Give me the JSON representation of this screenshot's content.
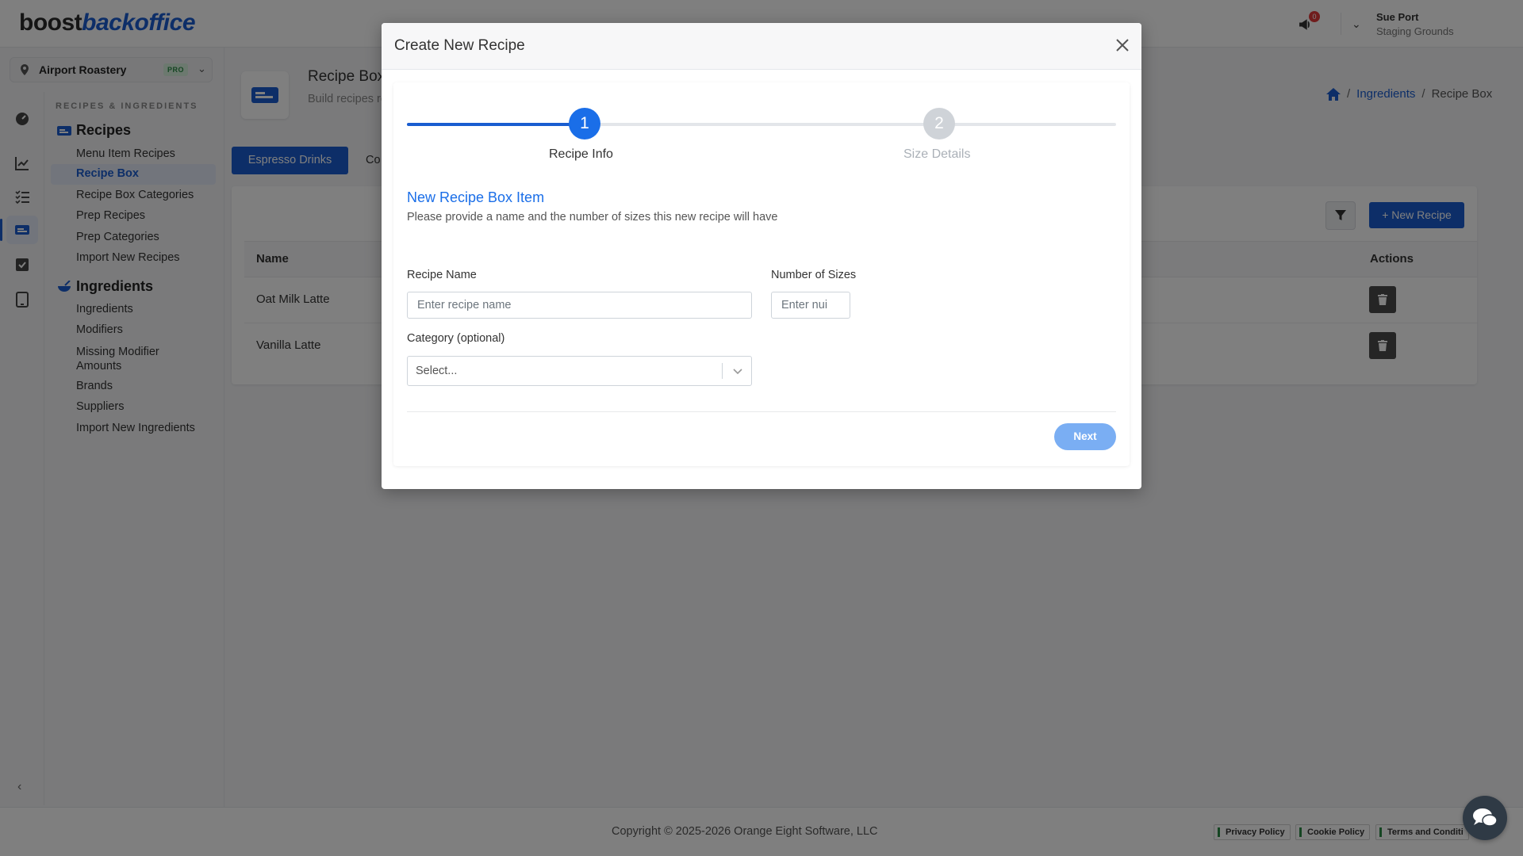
{
  "app": {
    "logo_part1": "boost",
    "logo_part2": "backoffice"
  },
  "header": {
    "notification_count": "0",
    "user_name": "Sue Port",
    "user_org": "Staging Grounds"
  },
  "location": {
    "name": "Airport Roastery",
    "badge": "PRO"
  },
  "sidebar": {
    "section_label": "RECIPES & INGREDIENTS",
    "groups": [
      {
        "label": "Recipes",
        "items": [
          "Menu Item Recipes",
          "Recipe Box",
          "Recipe Box Categories",
          "Prep Recipes",
          "Prep Categories",
          "Import New Recipes"
        ]
      },
      {
        "label": "Ingredients",
        "items": [
          "Ingredients",
          "Modifiers",
          "Missing Modifier Amounts",
          "Brands",
          "Suppliers",
          "Import New Ingredients"
        ]
      }
    ],
    "active_item": "Recipe Box"
  },
  "page": {
    "title": "Recipe Box",
    "description": "Build recipes recipe icon n",
    "breadcrumb": [
      "Ingredients",
      "Recipe Box"
    ]
  },
  "tabs": {
    "active": "Espresso Drinks",
    "next": "Co"
  },
  "table": {
    "new_button": "+ New Recipe",
    "columns": [
      "Name",
      "Actions"
    ],
    "rows": [
      {
        "name": "Oat Milk Latte"
      },
      {
        "name": "Vanilla Latte"
      }
    ]
  },
  "footer": {
    "copyright": "Copyright © 2025-2026 Orange Eight Software, LLC",
    "links": [
      "Privacy Policy",
      "Cookie Policy",
      "Terms and Conditi"
    ]
  },
  "modal": {
    "title": "Create New Recipe",
    "steps": [
      {
        "number": "1",
        "label": "Recipe Info"
      },
      {
        "number": "2",
        "label": "Size Details"
      }
    ],
    "section_title": "New Recipe Box Item",
    "section_desc": "Please provide a name and the number of sizes this new recipe will have",
    "recipe_name_label": "Recipe Name",
    "recipe_name_placeholder": "Enter recipe name",
    "sizes_label": "Number of Sizes",
    "sizes_placeholder": "Enter nui",
    "category_label": "Category (optional)",
    "category_placeholder": "Select...",
    "next_button": "Next"
  },
  "colors": {
    "primary": "#1a5dd0",
    "step_active": "#1a6ee8",
    "next_button": "#7aaef3"
  }
}
